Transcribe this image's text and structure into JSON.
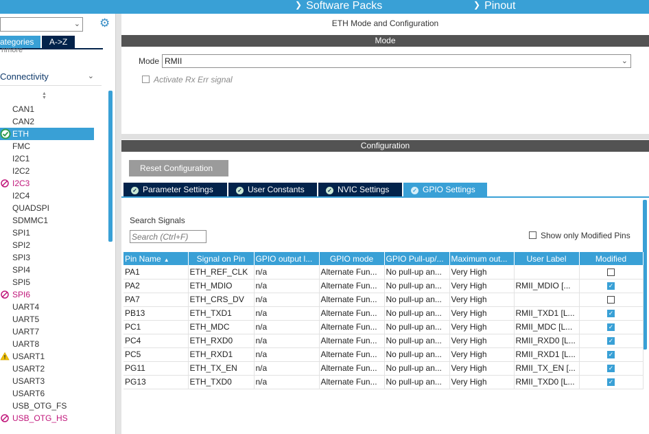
{
  "topbar": {
    "software_packs": "Software Packs",
    "pinout": "Pinout"
  },
  "sidebar": {
    "tab_categories": "ategories",
    "tab_az": "A->Z",
    "cut_text": "nmore",
    "group_label": "Connectivity",
    "items": [
      {
        "label": "CAN1",
        "status": "none"
      },
      {
        "label": "CAN2",
        "status": "none"
      },
      {
        "label": "ETH",
        "status": "ok"
      },
      {
        "label": "FMC",
        "status": "none"
      },
      {
        "label": "I2C1",
        "status": "none"
      },
      {
        "label": "I2C2",
        "status": "none"
      },
      {
        "label": "I2C3",
        "status": "blocked"
      },
      {
        "label": "I2C4",
        "status": "none"
      },
      {
        "label": "QUADSPI",
        "status": "none"
      },
      {
        "label": "SDMMC1",
        "status": "none"
      },
      {
        "label": "SPI1",
        "status": "none"
      },
      {
        "label": "SPI2",
        "status": "none"
      },
      {
        "label": "SPI3",
        "status": "none"
      },
      {
        "label": "SPI4",
        "status": "none"
      },
      {
        "label": "SPI5",
        "status": "none"
      },
      {
        "label": "SPI6",
        "status": "blocked"
      },
      {
        "label": "UART4",
        "status": "none"
      },
      {
        "label": "UART5",
        "status": "none"
      },
      {
        "label": "UART7",
        "status": "none"
      },
      {
        "label": "UART8",
        "status": "none"
      },
      {
        "label": "USART1",
        "status": "warning"
      },
      {
        "label": "USART2",
        "status": "none"
      },
      {
        "label": "USART3",
        "status": "none"
      },
      {
        "label": "USART6",
        "status": "none"
      },
      {
        "label": "USB_OTG_FS",
        "status": "none"
      },
      {
        "label": "USB_OTG_HS",
        "status": "blocked"
      }
    ]
  },
  "mode": {
    "title": "ETH Mode and Configuration",
    "banner": "Mode",
    "label": "Mode",
    "value": "RMII",
    "checkbox_label": "Activate Rx Err signal"
  },
  "config": {
    "banner": "Configuration",
    "reset_button": "Reset Configuration",
    "tabs": [
      {
        "label": "Parameter Settings"
      },
      {
        "label": "User Constants"
      },
      {
        "label": "NVIC Settings"
      },
      {
        "label": "GPIO Settings"
      }
    ],
    "search_label": "Search Signals",
    "search_placeholder": "Search (Ctrl+F)",
    "show_modified_label": "Show only Modified Pins",
    "columns": [
      "Pin Name",
      "Signal on Pin",
      "GPIO output l...",
      "GPIO mode",
      "GPIO Pull-up/...",
      "Maximum out...",
      "User Label",
      "Modified"
    ],
    "rows": [
      {
        "pin": "PA1",
        "signal": "ETH_REF_CLK",
        "output": "n/a",
        "mode": "Alternate Fun...",
        "pull": "No pull-up an...",
        "speed": "Very High",
        "label": "",
        "modified": false
      },
      {
        "pin": "PA2",
        "signal": "ETH_MDIO",
        "output": "n/a",
        "mode": "Alternate Fun...",
        "pull": "No pull-up an...",
        "speed": "Very High",
        "label": "RMII_MDIO [...",
        "modified": true
      },
      {
        "pin": "PA7",
        "signal": "ETH_CRS_DV",
        "output": "n/a",
        "mode": "Alternate Fun...",
        "pull": "No pull-up an...",
        "speed": "Very High",
        "label": "",
        "modified": false
      },
      {
        "pin": "PB13",
        "signal": "ETH_TXD1",
        "output": "n/a",
        "mode": "Alternate Fun...",
        "pull": "No pull-up an...",
        "speed": "Very High",
        "label": "RMII_TXD1 [L...",
        "modified": true
      },
      {
        "pin": "PC1",
        "signal": "ETH_MDC",
        "output": "n/a",
        "mode": "Alternate Fun...",
        "pull": "No pull-up an...",
        "speed": "Very High",
        "label": "RMII_MDC [L...",
        "modified": true
      },
      {
        "pin": "PC4",
        "signal": "ETH_RXD0",
        "output": "n/a",
        "mode": "Alternate Fun...",
        "pull": "No pull-up an...",
        "speed": "Very High",
        "label": "RMII_RXD0 [L...",
        "modified": true
      },
      {
        "pin": "PC5",
        "signal": "ETH_RXD1",
        "output": "n/a",
        "mode": "Alternate Fun...",
        "pull": "No pull-up an...",
        "speed": "Very High",
        "label": "RMII_RXD1 [L...",
        "modified": true
      },
      {
        "pin": "PG11",
        "signal": "ETH_TX_EN",
        "output": "n/a",
        "mode": "Alternate Fun...",
        "pull": "No pull-up an...",
        "speed": "Very High",
        "label": "RMII_TX_EN [...",
        "modified": true
      },
      {
        "pin": "PG13",
        "signal": "ETH_TXD0",
        "output": "n/a",
        "mode": "Alternate Fun...",
        "pull": "No pull-up an...",
        "speed": "Very High",
        "label": "RMII_TXD0 [L...",
        "modified": true
      }
    ]
  },
  "colors": {
    "accent": "#39a0d6",
    "dark": "#03234b",
    "banner": "#535353",
    "warning": "#c0157a"
  }
}
